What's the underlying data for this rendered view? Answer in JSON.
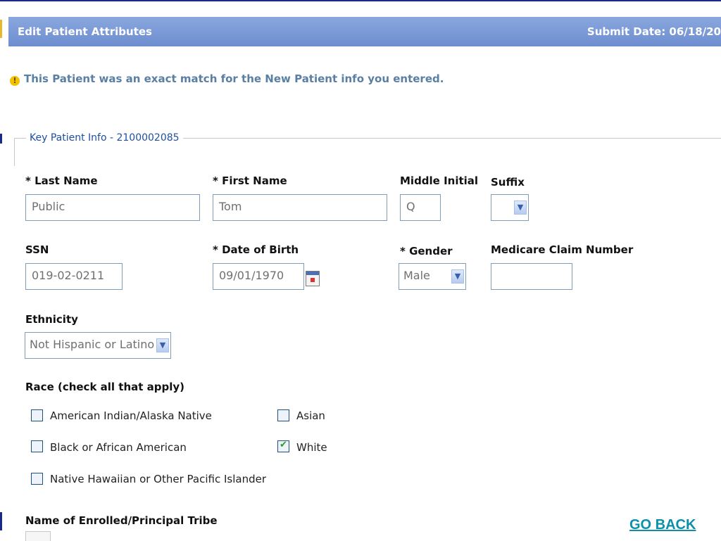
{
  "header": {
    "title": "Edit Patient Attributes",
    "submit_date": "Submit Date: 06/18/20"
  },
  "notice": {
    "icon": "warning-icon",
    "text": "This Patient was an exact match for the New Patient info you entered."
  },
  "section": {
    "legend": "Key Patient Info - 2100002085"
  },
  "fields": {
    "last_name": {
      "label": "* Last Name",
      "value": "Public"
    },
    "first_name": {
      "label": "* First Name",
      "value": "Tom"
    },
    "middle_initial": {
      "label": "Middle Initial",
      "value": "Q"
    },
    "suffix": {
      "label": "Suffix",
      "value": ""
    },
    "ssn": {
      "label": "SSN",
      "value": "019-02-0211"
    },
    "dob": {
      "label": "* Date of Birth",
      "value": "09/01/1970"
    },
    "gender": {
      "label": "* Gender",
      "value": "Male"
    },
    "medicare": {
      "label": "Medicare Claim Number",
      "value": ""
    },
    "ethnicity": {
      "label": "Ethnicity",
      "value": "Not Hispanic or Latino"
    }
  },
  "race": {
    "label": "Race (check all that apply)",
    "options": [
      {
        "label": "American Indian/Alaska Native",
        "checked": false
      },
      {
        "label": "Asian",
        "checked": false
      },
      {
        "label": "Black or African American",
        "checked": false
      },
      {
        "label": "White",
        "checked": true
      },
      {
        "label": "Native Hawaiian or Other Pacific Islander",
        "checked": false
      }
    ]
  },
  "tribe": {
    "label": "Name of Enrolled/Principal Tribe"
  },
  "nav": {
    "go_back": "GO BACK"
  },
  "colors": {
    "header_bg": "#7b9bd6",
    "notice_text": "#5a7fa3",
    "legend_text": "#1f4fa0",
    "link": "#0c8fa8"
  }
}
